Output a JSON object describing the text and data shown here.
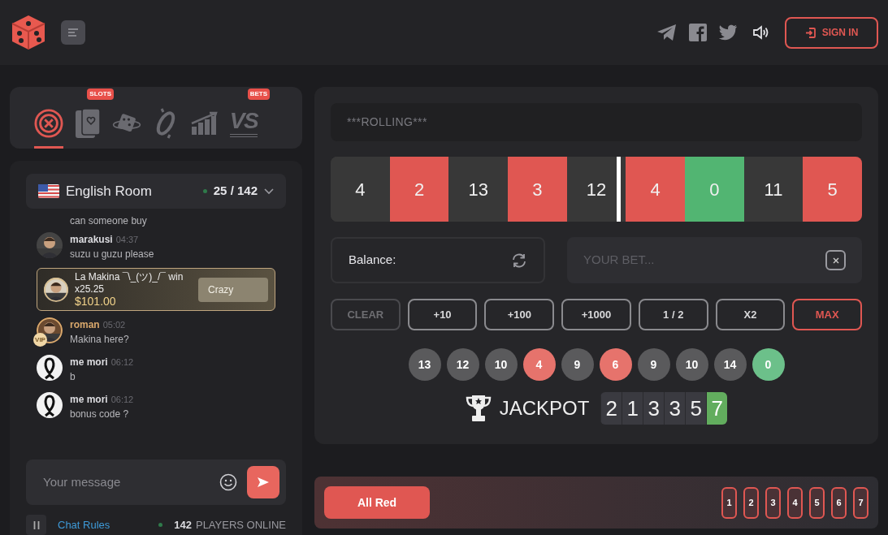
{
  "header": {
    "sign_in": "SIGN IN"
  },
  "game_tabs": [
    {
      "kind": "roulette",
      "selected": true
    },
    {
      "kind": "cards",
      "selected": false,
      "badge": "SLOTS"
    },
    {
      "kind": "dice",
      "selected": false
    },
    {
      "kind": "coinflip",
      "selected": false
    },
    {
      "kind": "crash",
      "selected": false
    },
    {
      "kind": "versus",
      "selected": false,
      "glyph": "VS",
      "badge": "BETS"
    }
  ],
  "chat": {
    "room": "English Room",
    "online_count": "25 / 142",
    "messages": [
      {
        "kind": "cut",
        "text": "can someone buy"
      },
      {
        "user": "marakusi",
        "time": "04:37",
        "text": "suzu u guzu please",
        "vip": false
      },
      {
        "kind": "win",
        "user": "La Makina ¯\\_(ツ)_/¯ win",
        "multiplier": "x25.25",
        "amount": "$101.00",
        "game": "Crazy"
      },
      {
        "user": "roman",
        "time": "05:02",
        "text": "Makina here?",
        "vip": true,
        "vip_label": "VIP"
      },
      {
        "kind": "ribbon",
        "user": "me mori",
        "time": "06:12",
        "text": "b",
        "vip": false
      },
      {
        "kind": "ribbon",
        "user": "me mori",
        "time": "06:12",
        "text": "bonus code ?",
        "vip": false
      }
    ],
    "input": {
      "placeholder": "Your message"
    },
    "rules_link": "Chat Rules",
    "players_count": "142",
    "players_label": "PLAYERS ONLINE"
  },
  "game": {
    "status": "***ROLLING***",
    "strip": [
      {
        "number": "4",
        "kind": "black"
      },
      {
        "number": "2",
        "kind": "red"
      },
      {
        "number": "13",
        "kind": "black"
      },
      {
        "number": "3",
        "kind": "red"
      },
      {
        "number": "12",
        "kind": "black"
      },
      {
        "number": "4",
        "kind": "red"
      },
      {
        "number": "0",
        "kind": "green"
      },
      {
        "number": "11",
        "kind": "black"
      },
      {
        "number": "5",
        "kind": "red"
      }
    ],
    "balance_label": "Balance:",
    "bet": {
      "placeholder": "YOUR BET..."
    },
    "bet_buttons": [
      {
        "label": "CLEAR",
        "kind": "muted"
      },
      {
        "label": "+10",
        "kind": "normal"
      },
      {
        "label": "+100",
        "kind": "normal"
      },
      {
        "label": "+1000",
        "kind": "normal"
      },
      {
        "label": "1 / 2",
        "kind": "normal"
      },
      {
        "label": "X2",
        "kind": "normal"
      },
      {
        "label": "MAX",
        "kind": "danger"
      }
    ],
    "history": [
      {
        "number": "13",
        "kind": "black"
      },
      {
        "number": "12",
        "kind": "black"
      },
      {
        "number": "10",
        "kind": "black"
      },
      {
        "number": "4",
        "kind": "red"
      },
      {
        "number": "9",
        "kind": "black"
      },
      {
        "number": "6",
        "kind": "red"
      },
      {
        "number": "9",
        "kind": "black"
      },
      {
        "number": "10",
        "kind": "black"
      },
      {
        "number": "14",
        "kind": "black"
      },
      {
        "number": "0",
        "kind": "green"
      }
    ],
    "jackpot_label": "JACKPOT",
    "jackpot_digits": [
      {
        "digit": "2",
        "highlighted": false
      },
      {
        "digit": "1",
        "highlighted": false
      },
      {
        "digit": "3",
        "highlighted": false
      },
      {
        "digit": "3",
        "highlighted": false
      },
      {
        "digit": "5",
        "highlighted": false
      },
      {
        "digit": "7",
        "highlighted": true
      }
    ]
  },
  "bet_bar": {
    "button": "All Red",
    "chips": [
      "1",
      "2",
      "3",
      "4",
      "5",
      "6",
      "7"
    ]
  }
}
